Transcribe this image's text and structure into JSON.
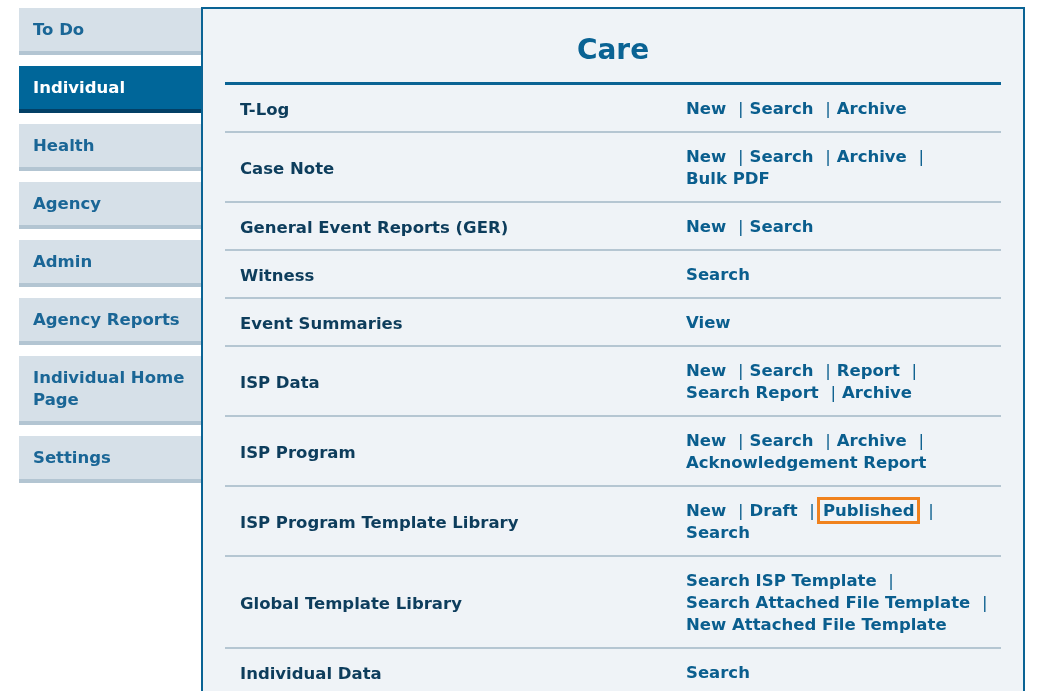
{
  "sidebar": {
    "items": [
      {
        "label": "To Do",
        "selected": false
      },
      {
        "label": "Individual",
        "selected": true
      },
      {
        "label": "Health",
        "selected": false
      },
      {
        "label": "Agency",
        "selected": false
      },
      {
        "label": "Admin",
        "selected": false
      },
      {
        "label": "Agency Reports",
        "selected": false
      },
      {
        "label": "Individual Home Page",
        "selected": false
      },
      {
        "label": "Settings",
        "selected": false
      }
    ]
  },
  "panel": {
    "title": "Care",
    "separator": "|",
    "rows": [
      {
        "name": "T-Log",
        "link_lines": [
          [
            {
              "label": "New",
              "highlighted": false
            },
            {
              "label": "Search",
              "highlighted": false
            },
            {
              "label": "Archive",
              "highlighted": false
            }
          ]
        ]
      },
      {
        "name": "Case Note",
        "link_lines": [
          [
            {
              "label": "New",
              "highlighted": false
            },
            {
              "label": "Search",
              "highlighted": false
            },
            {
              "label": "Archive",
              "highlighted": false
            }
          ],
          [
            {
              "label": "Bulk PDF",
              "highlighted": false
            }
          ]
        ]
      },
      {
        "name": "General Event Reports (GER)",
        "link_lines": [
          [
            {
              "label": "New",
              "highlighted": false
            },
            {
              "label": "Search",
              "highlighted": false
            }
          ]
        ]
      },
      {
        "name": "Witness",
        "link_lines": [
          [
            {
              "label": "Search",
              "highlighted": false
            }
          ]
        ]
      },
      {
        "name": "Event Summaries",
        "link_lines": [
          [
            {
              "label": "View",
              "highlighted": false
            }
          ]
        ]
      },
      {
        "name": "ISP Data",
        "link_lines": [
          [
            {
              "label": "New",
              "highlighted": false
            },
            {
              "label": "Search",
              "highlighted": false
            },
            {
              "label": "Report",
              "highlighted": false
            }
          ],
          [
            {
              "label": "Search Report",
              "highlighted": false
            },
            {
              "label": "Archive",
              "highlighted": false
            }
          ]
        ]
      },
      {
        "name": "ISP Program",
        "link_lines": [
          [
            {
              "label": "New",
              "highlighted": false
            },
            {
              "label": "Search",
              "highlighted": false
            },
            {
              "label": "Archive",
              "highlighted": false
            }
          ],
          [
            {
              "label": "Acknowledgement Report",
              "highlighted": false
            }
          ]
        ]
      },
      {
        "name": "ISP Program Template Library",
        "link_lines": [
          [
            {
              "label": "New",
              "highlighted": false
            },
            {
              "label": "Draft",
              "highlighted": false
            },
            {
              "label": "Published",
              "highlighted": true
            }
          ],
          [
            {
              "label": "Search",
              "highlighted": false
            }
          ]
        ]
      },
      {
        "name": "Global Template Library",
        "link_lines": [
          [
            {
              "label": "Search ISP Template",
              "highlighted": false
            }
          ],
          [
            {
              "label": "Search Attached File Template",
              "highlighted": false
            }
          ],
          [
            {
              "label": "New Attached File Template",
              "highlighted": false
            }
          ]
        ]
      },
      {
        "name": "Individual Data",
        "link_lines": [
          [
            {
              "label": "Search",
              "highlighted": false
            }
          ]
        ]
      }
    ]
  }
}
